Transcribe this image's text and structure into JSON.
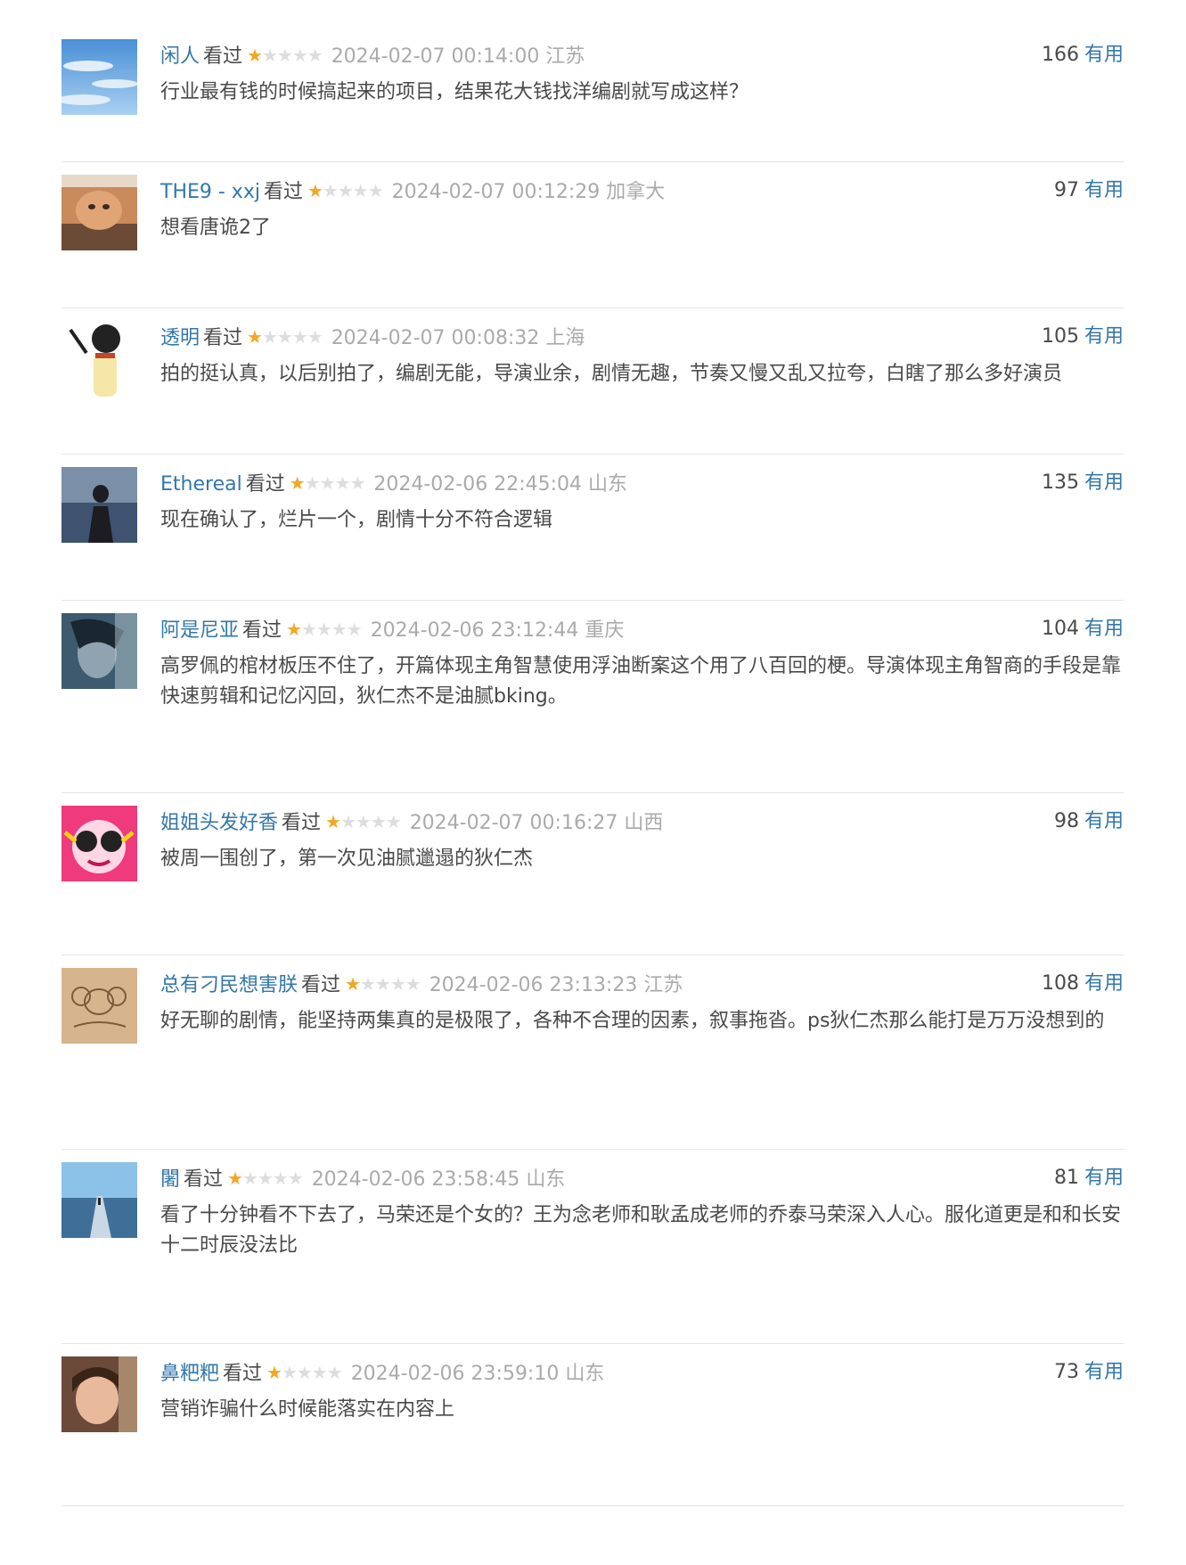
{
  "comments": [
    {
      "user": "闲人",
      "action": "看过",
      "rating": 1,
      "time": "2024-02-07 00:14:00",
      "location": "江苏",
      "votes": "166",
      "useful_label": "有用",
      "text": "行业最有钱的时候搞起来的项目，结果花大钱找洋编剧就写成这样？",
      "avatar": "sky-avatar"
    },
    {
      "user": "THE9 - xxj",
      "action": "看过",
      "rating": 1,
      "time": "2024-02-07 00:12:29",
      "location": "加拿大",
      "votes": "97",
      "useful_label": "有用",
      "text": "想看唐诡2了",
      "avatar": "cat-avatar"
    },
    {
      "user": "透明",
      "action": "看过",
      "rating": 1,
      "time": "2024-02-07 00:08:32",
      "location": "上海",
      "votes": "105",
      "useful_label": "有用",
      "text": "拍的挺认真，以后别拍了，编剧无能，导演业余，剧情无趣，节奏又慢又乱又拉夸，白瞎了那么多好演员",
      "avatar": "cartoon-avatar"
    },
    {
      "user": "Ethereal",
      "action": "看过",
      "rating": 1,
      "time": "2024-02-06 22:45:04",
      "location": "山东",
      "votes": "135",
      "useful_label": "有用",
      "text": "现在确认了，烂片一个，剧情十分不符合逻辑",
      "avatar": "sea-avatar"
    },
    {
      "user": "阿是尼亚",
      "action": "看过",
      "rating": 1,
      "time": "2024-02-06 23:12:44",
      "location": "重庆",
      "votes": "104",
      "useful_label": "有用",
      "text": "高罗佩的棺材板压不住了，开篇体现主角智慧使用浮油断案这个用了八百回的梗。导演体现主角智商的手段是靠快速剪辑和记忆闪回，狄仁杰不是油腻bking。",
      "avatar": "portrait-avatar"
    },
    {
      "user": "姐姐头发好香",
      "action": "看过",
      "rating": 1,
      "time": "2024-02-07 00:16:27",
      "location": "山西",
      "votes": "98",
      "useful_label": "有用",
      "text": "被周一围创了，第一次见油腻邋遢的狄仁杰",
      "avatar": "pink-cartoon-avatar"
    },
    {
      "user": "总有刁民想害朕",
      "action": "看过",
      "rating": 1,
      "time": "2024-02-06 23:13:23",
      "location": "江苏",
      "votes": "108",
      "useful_label": "有用",
      "text": "好无聊的剧情，能坚持两集真的是极限了，各种不合理的因素，叙事拖沓。ps狄仁杰那么能打是万万没想到的",
      "avatar": "koala-avatar"
    },
    {
      "user": "闍",
      "action": "看过",
      "rating": 1,
      "time": "2024-02-06 23:58:45",
      "location": "山东",
      "votes": "81",
      "useful_label": "有用",
      "text": "看了十分钟看不下去了，马荣还是个女的？王为念老师和耿孟成老师的乔泰马荣深入人心。服化道更是和和长安十二时辰没法比",
      "avatar": "road-avatar"
    },
    {
      "user": "鼻粑粑",
      "action": "看过",
      "rating": 1,
      "time": "2024-02-06 23:59:10",
      "location": "山东",
      "votes": "73",
      "useful_label": "有用",
      "text": "营销诈骗什么时候能落实在内容上",
      "avatar": "child-avatar"
    }
  ]
}
